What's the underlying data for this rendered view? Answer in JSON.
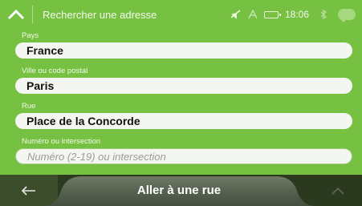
{
  "header": {
    "search_title": "Rechercher une adresse",
    "clock": "18:06"
  },
  "form": {
    "country_label": "Pays",
    "country_value": "France",
    "city_label": "Ville ou code postal",
    "city_value": "Paris",
    "street_label": "Rue",
    "street_value": "Place de la Concorde",
    "number_label": "Numéro ou intersection",
    "number_placeholder": "Numéro (2-19) ou intersection"
  },
  "footer": {
    "back_icon": "arrow-left",
    "main_button_label": "Aller à une rue",
    "up_icon": "chevron-up"
  },
  "colors": {
    "primary_green": "#76c142",
    "bottom_bar": "#2b3a1f"
  }
}
